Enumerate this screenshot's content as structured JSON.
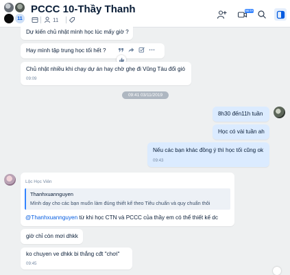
{
  "header": {
    "title": "PCCC 10-Thầy Thanh",
    "avatar_count": "11",
    "member_count": "11",
    "beta_label": "BETA"
  },
  "messages": {
    "m1": {
      "text": "Dự kiến chủ nhật mình học lúc mấy giờ ?"
    },
    "m2": {
      "text": "Hay mình tập trung học tối hết ?"
    },
    "m3": {
      "text": "Chủ nhật nhiều khi chạy dự án hay chờ ghẹ đi Vũng Tàu đổi gió",
      "time": "09:09"
    },
    "date_separator": "09:41 03/11/2019",
    "m4": {
      "text": "8h30 đến11h tuần"
    },
    "m5": {
      "text": "Học có vài tuần ah"
    },
    "m6": {
      "text": "Nếu các bạn khác đồng ý thì học tối cũng ok",
      "time": "09:43"
    },
    "m7": {
      "sender": "Lộc Học Viên",
      "quote_name": "Thanhxuannguyen",
      "quote_text": "Mình dạy cho các bạn muốn làm đúng thiết kế theo Tiêu chuẩn và quy chuẩn thôi",
      "mention": "@Thanhxuannguyen",
      "text": "từ khi học CTN và PCCC của thầy em có thể thiết kế dc"
    },
    "m8": {
      "text": "giờ chỉ còn mơi dhkk"
    },
    "m9": {
      "text": "ko chuyen ve dhkk bi thắng cđt \"chơi\"",
      "time": "09:45"
    }
  },
  "colors": {
    "accent": "#005ae0",
    "my_bubble": "#dbebff",
    "background": "#eef0f1"
  },
  "icons": [
    "add-member-icon",
    "video-call-icon",
    "search-icon",
    "sidebar-toggle-icon",
    "calendar-icon",
    "members-icon",
    "tag-icon",
    "quote-icon",
    "share-icon",
    "checklist-icon",
    "more-icon",
    "like-icon"
  ]
}
